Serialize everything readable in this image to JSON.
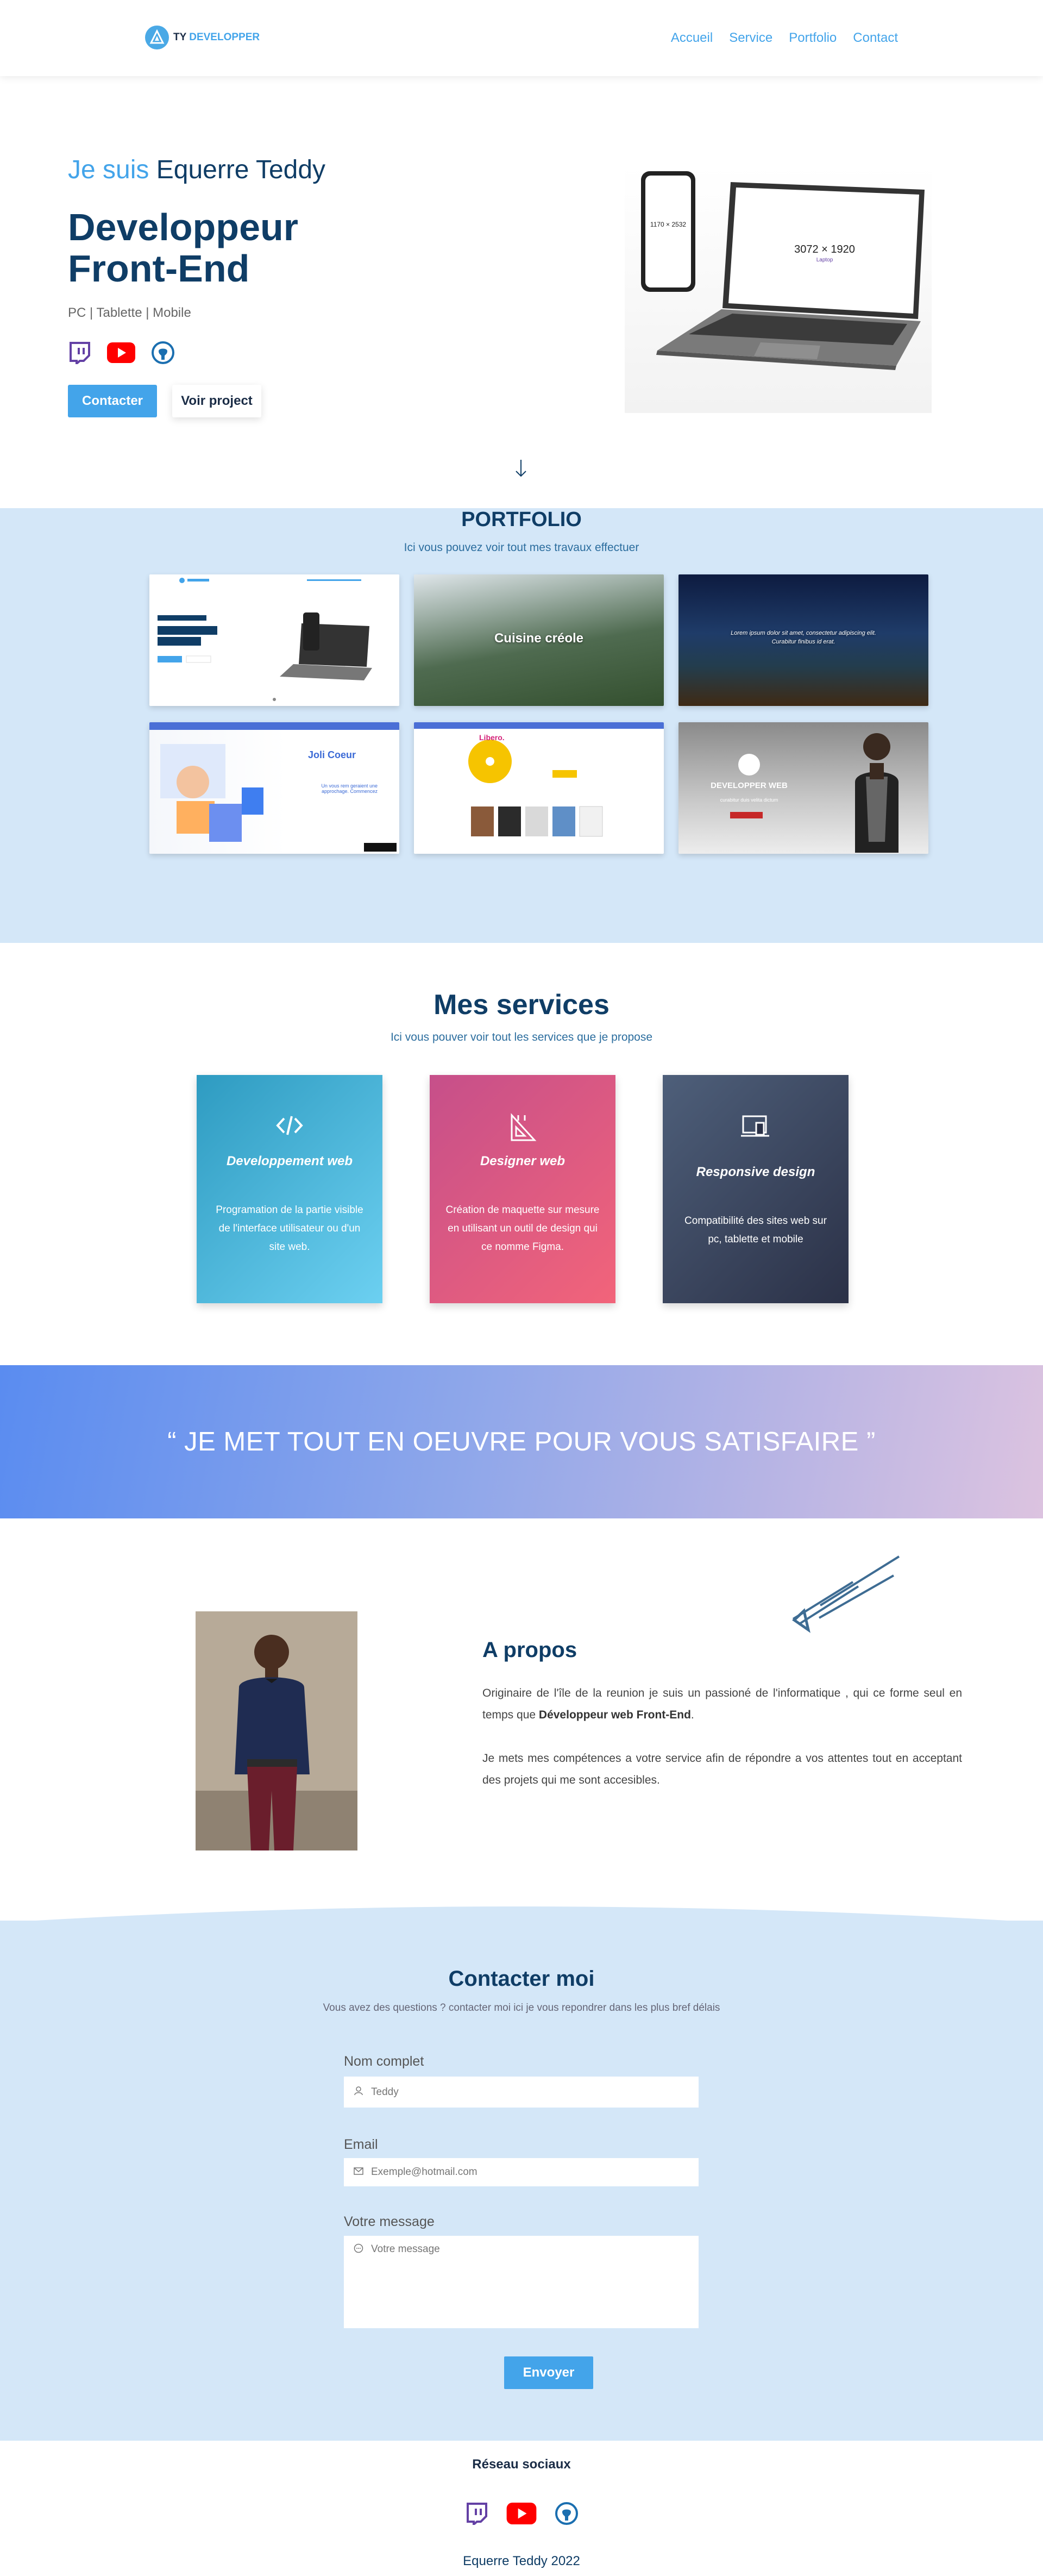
{
  "nav": {
    "logo_prefix": "TY",
    "logo_suffix": "DEVELOPPER",
    "links": [
      "Accueil",
      "Service",
      "Portfolio",
      "Contact"
    ]
  },
  "hero": {
    "intro_prefix": "Je suis",
    "intro_name": "Equerre Teddy",
    "title": "Developpeur Front-End",
    "subtitle": "PC | Tablette | Mobile",
    "btn_contact": "Contacter",
    "btn_project": "Voir project",
    "phone_res": "1170 × 2532",
    "laptop_res": "3072 × 1920",
    "laptop_sub": "Laptop"
  },
  "portfolio": {
    "title": "PORTFOLIO",
    "subtitle": "Ici vous pouvez voir tout mes travaux  effectuer",
    "cards": [
      {
        "label": ""
      },
      {
        "label": "Cuisine créole"
      },
      {
        "label": "Lorem ipsum dolor sit amet, consectetur adipiscing elit. Curabitur finibus id erat."
      },
      {
        "label": "Joli Coeur",
        "sub": "Un vous rem geraient une approchage. Commencez"
      },
      {
        "label": "Libero.",
        "sub": ""
      },
      {
        "label": "DEVELOPPER WEB",
        "sub": "curabitur duis velita dictum"
      }
    ]
  },
  "services": {
    "title": "Mes services",
    "subtitle": "Ici vous pouver voir tout les services que je propose",
    "items": [
      {
        "title": "Developpement web",
        "text": "Programation de la partie visible de l'interface utilisateur ou d'un site web."
      },
      {
        "title": "Designer web",
        "text": "Création de maquette sur mesure en utilisant un outil de design qui ce nomme Figma."
      },
      {
        "title": "Responsive design",
        "text": "Compatibilité des sites web sur pc, tablette et mobile"
      }
    ]
  },
  "quote": {
    "text": "“ JE MET TOUT EN OEUVRE POUR VOUS SATISFAIRE ”"
  },
  "about": {
    "title": "A propos",
    "p1_before": "Originaire de l'île de la reunion je suis un passioné de l'informatique , qui ce forme seul en temps que ",
    "p1_bold": "Développeur web Front-End",
    "p1_after": ".",
    "p2": "Je mets mes compétences a votre service afin de répondre a vos attentes tout en acceptant des projets qui me sont accesibles."
  },
  "contact": {
    "title": "Contacter moi",
    "subtitle": "Vous avez des questions ? contacter moi ici je vous repondrer dans les plus bref délais",
    "name_label": "Nom complet",
    "name_placeholder": "Teddy",
    "email_label": "Email",
    "email_placeholder": "Exemple@hotmail.com",
    "message_label": "Votre message",
    "message_placeholder": "Votre message",
    "send": "Envoyer"
  },
  "footer": {
    "title": "Réseau sociaux",
    "copyright": "Equerre Teddy 2022"
  },
  "colors": {
    "accent": "#43a4ea",
    "navy": "#0f3d66",
    "light_blue_bg": "#d4e7f8",
    "twitch": "#6441a5",
    "youtube": "#ff0000",
    "github": "#1b6fb0"
  },
  "icons": [
    "logo-icon",
    "twitch-icon",
    "youtube-icon",
    "github-icon",
    "arrow-down-icon",
    "code-icon",
    "design-icon",
    "responsive-icon",
    "user-icon",
    "mail-icon",
    "message-icon",
    "pen-icon"
  ]
}
